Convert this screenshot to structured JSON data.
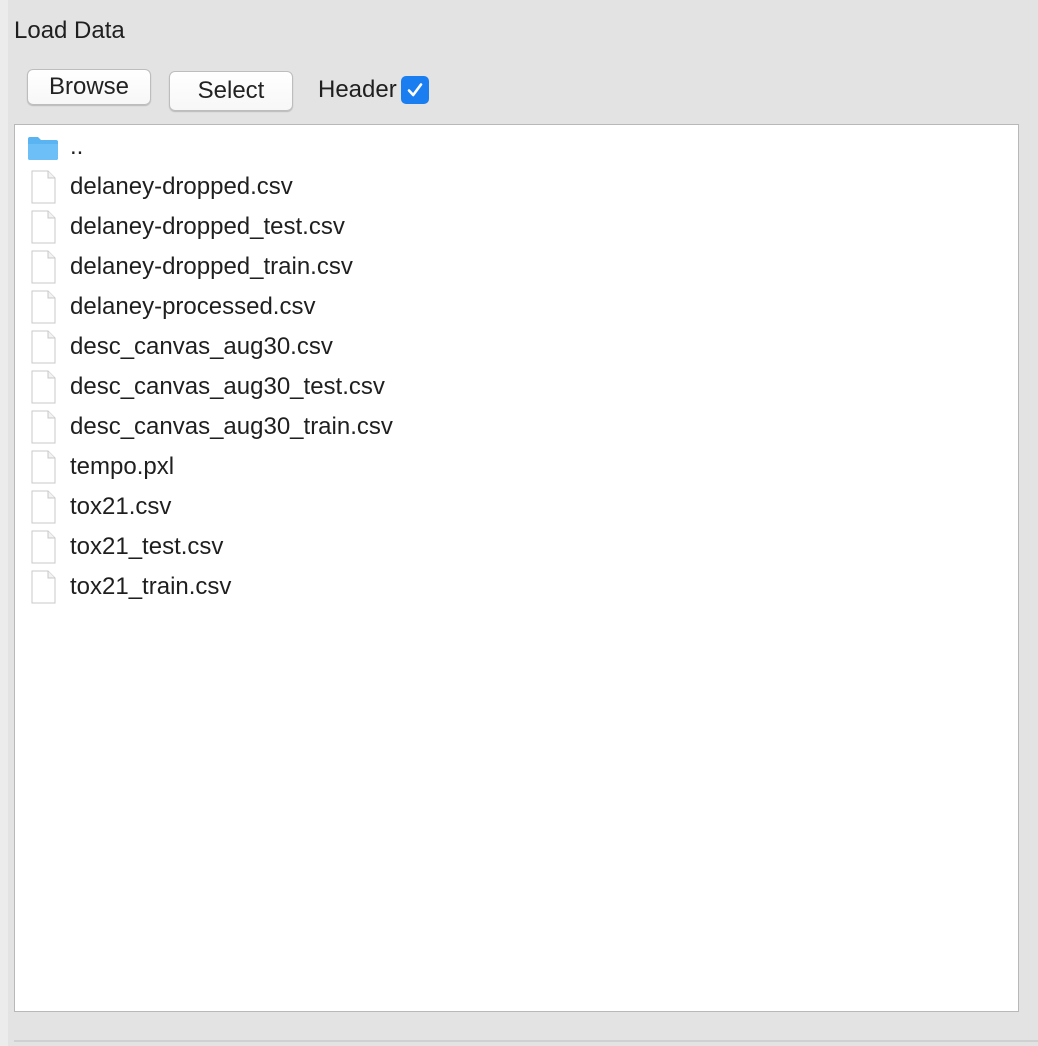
{
  "panel": {
    "title": "Load Data"
  },
  "toolbar": {
    "browse_label": "Browse",
    "select_label": "Select",
    "header_label": "Header",
    "header_checked": true
  },
  "file_list": {
    "items": [
      {
        "name": "..",
        "type": "folder",
        "icon": "folder-icon"
      },
      {
        "name": "delaney-dropped.csv",
        "type": "file",
        "icon": "file-icon"
      },
      {
        "name": "delaney-dropped_test.csv",
        "type": "file",
        "icon": "file-icon"
      },
      {
        "name": "delaney-dropped_train.csv",
        "type": "file",
        "icon": "file-icon"
      },
      {
        "name": "delaney-processed.csv",
        "type": "file",
        "icon": "file-icon"
      },
      {
        "name": "desc_canvas_aug30.csv",
        "type": "file",
        "icon": "file-icon"
      },
      {
        "name": "desc_canvas_aug30_test.csv",
        "type": "file",
        "icon": "file-icon"
      },
      {
        "name": "desc_canvas_aug30_train.csv",
        "type": "file",
        "icon": "file-icon"
      },
      {
        "name": "tempo.pxl",
        "type": "file",
        "icon": "file-icon"
      },
      {
        "name": "tox21.csv",
        "type": "file",
        "icon": "file-icon"
      },
      {
        "name": "tox21_test.csv",
        "type": "file",
        "icon": "file-icon"
      },
      {
        "name": "tox21_train.csv",
        "type": "file",
        "icon": "file-icon"
      }
    ]
  },
  "colors": {
    "background": "#e3e3e3",
    "list_background": "#ffffff",
    "checkbox_accent": "#1b7ef0",
    "folder_color": "#5ab4f2"
  }
}
